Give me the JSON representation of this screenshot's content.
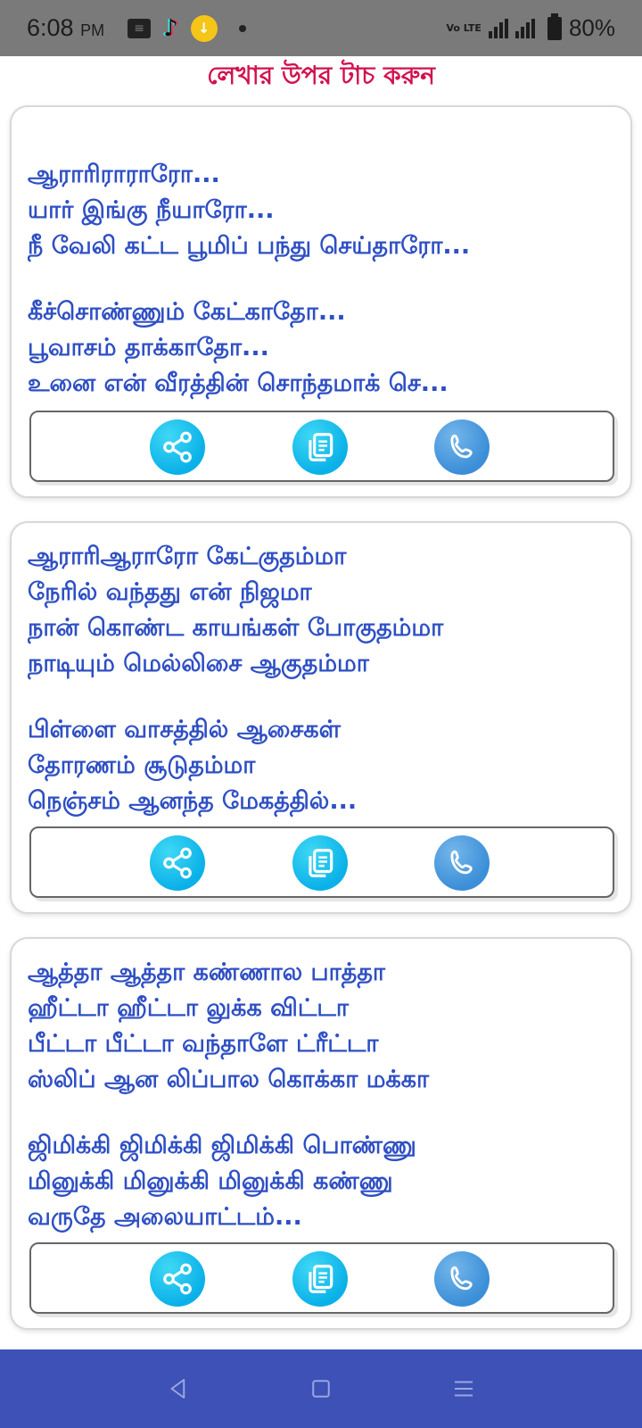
{
  "status_bar": {
    "time": "6:08",
    "ampm": "PM",
    "network_label": "Vo LTE",
    "battery": "80%"
  },
  "header": {
    "title": "লেখার উপর টাচ করুন"
  },
  "cards": [
    {
      "stanza1": [
        "ஆராரிராராரோ...",
        "யார் இங்கு நீயாரோ...",
        "நீ வேலி கட்ட பூமிப் பந்து செய்தாரோ..."
      ],
      "stanza2": [
        "கீச்சொண்ணும் கேட்காதோ...",
        "பூவாசம் தாக்காதோ...",
        "உனை என் வீரத்தின் சொந்தமாக் செ..."
      ]
    },
    {
      "stanza1": [
        "ஆராரிஆராரோ கேட்குதம்மா",
        "நேரில் வந்தது என் நிஜமா",
        "நான் கொண்ட காயங்கள் போகுதம்மா",
        "நாடியும் மெல்லிசை ஆகுதம்மா"
      ],
      "stanza2": [
        "பிள்ளை வாசத்தில் ஆசைகள்",
        "தோரணம் சூடுதம்மா",
        "நெஞ்சம் ஆனந்த மேகத்தில்..."
      ]
    },
    {
      "stanza1": [
        "ஆத்தா ஆத்தா கண்ணால பாத்தா",
        "ஹீட்டா ஹீட்டா லுக்க விட்டா",
        "பீட்டா பீட்டா வந்தாளே ட்ரீட்டா",
        "ஸ்லிப் ஆன லிப்பால கொக்கா மக்கா"
      ],
      "stanza2": [
        "ஜிமிக்கி ஜிமிக்கி ஜிமிக்கி பொண்ணு",
        "மினுக்கி மினுக்கி மினுக்கி கண்ணு",
        "வருதே அலையாட்டம்..."
      ]
    }
  ],
  "icons": {
    "share": "share-icon",
    "copy": "copy-icon",
    "call": "whatsapp-call-icon",
    "back": "back-icon",
    "home": "home-icon",
    "menu": "menu-icon"
  },
  "colors": {
    "lyrics": "#2e4fc4",
    "header": "#d2124f",
    "nav_bar": "#3d51b6",
    "status_bar": "#7a7a7a",
    "button": "#0ab1e8"
  }
}
